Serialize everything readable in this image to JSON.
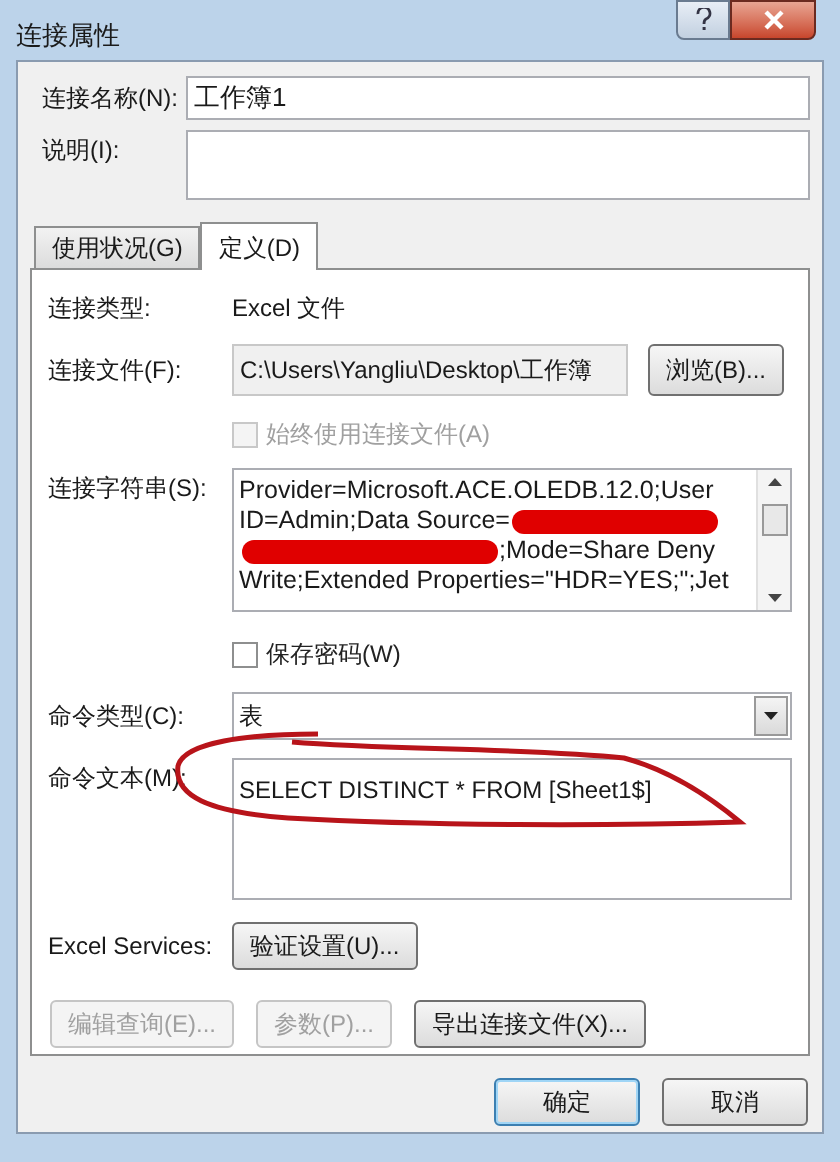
{
  "window": {
    "title": "连接属性"
  },
  "connection_name": {
    "label": "连接名称(N):",
    "value": "工作簿1"
  },
  "description": {
    "label": "说明(I):"
  },
  "tabs": [
    {
      "label": "使用状况(G)",
      "selected": false
    },
    {
      "label": "定义(D)",
      "selected": true
    }
  ],
  "definition": {
    "connection_type": {
      "label": "连接类型:",
      "value": "Excel 文件"
    },
    "connection_file": {
      "label": "连接文件(F):",
      "value": "C:\\Users\\Yangliu\\Desktop\\工作簿",
      "button": "浏览(B)..."
    },
    "always_use_file": {
      "label": "始终使用连接文件(A)",
      "checked": false,
      "disabled": true
    },
    "connection_string": {
      "label": "连接字符串(S):",
      "lines": [
        {
          "text": "Provider=Microsoft.ACE.OLEDB.12.0;User",
          "redacted_before": false,
          "redacted_after": false
        },
        {
          "text": "ID=Admin;Data Source=",
          "redacted_before": false,
          "redacted_after": true
        },
        {
          "text": ";Mode=Share Deny",
          "redacted_before": true,
          "redacted_after": false
        },
        {
          "text": "Write;Extended Properties=\"HDR=YES;\";Jet",
          "redacted_before": false,
          "redacted_after": false
        }
      ]
    },
    "save_password": {
      "label": "保存密码(W)",
      "checked": false,
      "disabled": false
    },
    "command_type": {
      "label": "命令类型(C):",
      "value": "表"
    },
    "command_text": {
      "label": "命令文本(M):",
      "value": "SELECT DISTINCT * FROM [Sheet1$]"
    },
    "excel_services": {
      "label": "Excel Services:",
      "button": "验证设置(U)..."
    },
    "buttons": [
      {
        "label": "编辑查询(E)...",
        "disabled": true
      },
      {
        "label": "参数(P)...",
        "disabled": true
      },
      {
        "label": "导出连接文件(X)...",
        "disabled": false
      }
    ]
  },
  "dialog_buttons": [
    {
      "label": "确定",
      "default": true
    },
    {
      "label": "取消",
      "default": false
    }
  ]
}
